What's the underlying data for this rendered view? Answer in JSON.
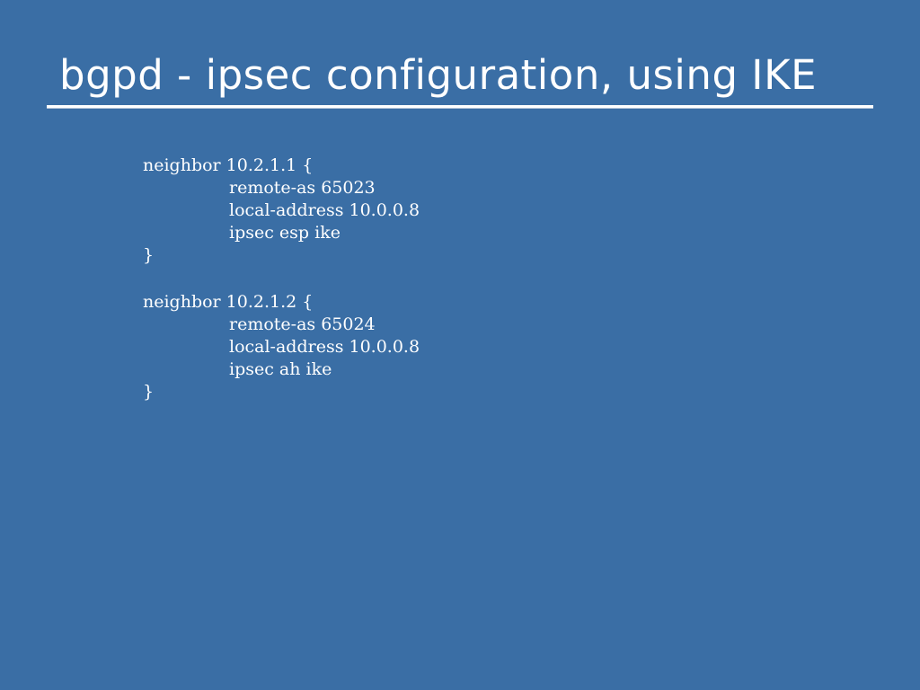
{
  "slide": {
    "title": "bgpd - ipsec configuration, using IKE",
    "neighbors": [
      {
        "open": "neighbor 10.2.1.1 {",
        "remote_as": "remote-as 65023",
        "local_address": "local-address 10.0.0.8",
        "ipsec": "ipsec esp ike",
        "close": "}"
      },
      {
        "open": "neighbor 10.2.1.2 {",
        "remote_as": "remote-as 65024",
        "local_address": "local-address 10.0.0.8",
        "ipsec": "ipsec ah ike",
        "close": "}"
      }
    ]
  },
  "colors": {
    "background": "#3a6ea5",
    "text": "#ffffff"
  }
}
